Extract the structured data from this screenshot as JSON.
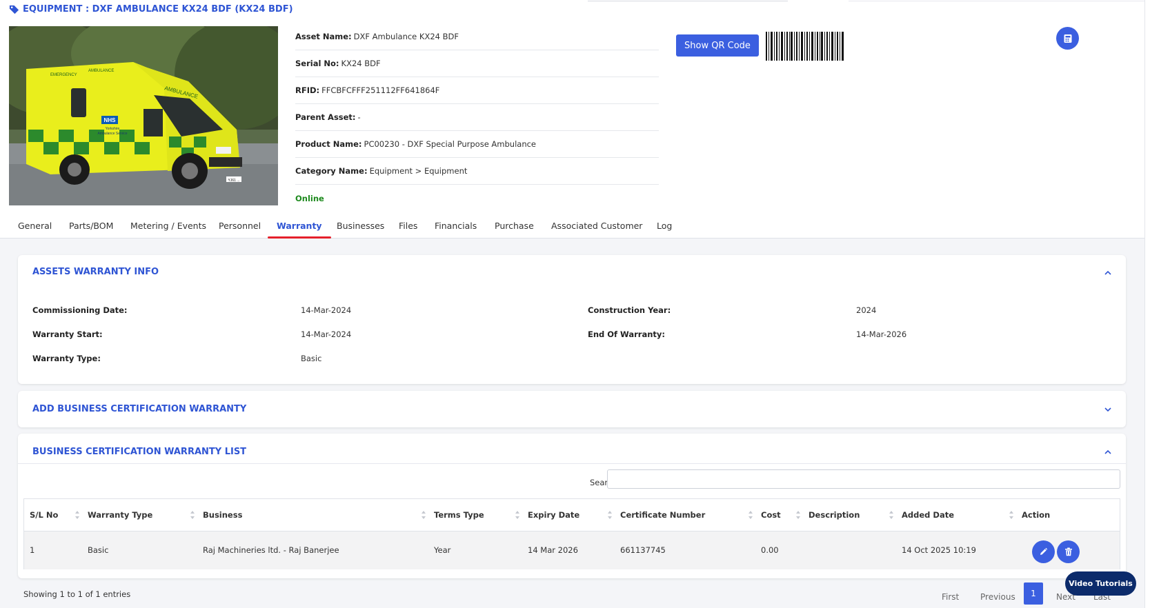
{
  "page": {
    "title": "EQUIPMENT : DXF AMBULANCE KX24 BDF (KX24 BDF)"
  },
  "asset": {
    "fields": [
      {
        "key": "Asset Name:",
        "value": "DXF Ambulance KX24 BDF"
      },
      {
        "key": "Serial No:",
        "value": "KX24 BDF"
      },
      {
        "key": "RFID:",
        "value": "FFCBFCFFF251112FF641864F"
      },
      {
        "key": "Parent Asset:",
        "value": "-"
      },
      {
        "key": "Product Name:",
        "value": "PC00230 - DXF Special Purpose Ambulance"
      },
      {
        "key": "Category Name:",
        "value": "Equipment > Equipment"
      }
    ],
    "status": "Online",
    "photo_text": {
      "emergency": "EMERGENCY",
      "ambulance": "AMBULANCE",
      "nhs": "NHS",
      "service_line1": "Yorkshire",
      "service_line2": "Ambulance Service",
      "front": "AMBULANCE",
      "plate": "YJ61 ..."
    }
  },
  "actions": {
    "qr_button": "Show QR Code"
  },
  "tabs": [
    "General",
    "Parts/BOM",
    "Metering / Events",
    "Personnel",
    "Warranty",
    "Businesses",
    "Files",
    "Financials",
    "Purchase",
    "Associated Customer",
    "Log"
  ],
  "active_tab": "Warranty",
  "warranty_info": {
    "title": "ASSETS WARRANTY INFO",
    "commissioning_date_label": "Commissioning Date:",
    "commissioning_date": "14-Mar-2024",
    "construction_year_label": "Construction Year:",
    "construction_year": "2024",
    "warranty_start_label": "Warranty Start:",
    "warranty_start": "14-Mar-2024",
    "end_of_warranty_label": "End Of Warranty:",
    "end_of_warranty": "14-Mar-2026",
    "warranty_type_label": "Warranty Type:",
    "warranty_type": "Basic"
  },
  "add_cert": {
    "title": "ADD BUSINESS CERTIFICATION WARRANTY"
  },
  "cert_list": {
    "title": "BUSINESS CERTIFICATION WARRANTY LIST",
    "search_label": "Search:",
    "search_value": "",
    "columns": [
      "S/L No",
      "Warranty Type",
      "Business",
      "Terms Type",
      "Expiry Date",
      "Certificate Number",
      "Cost",
      "Description",
      "Added Date",
      "Action"
    ],
    "rows": [
      {
        "sl": "1",
        "warranty_type": "Basic",
        "business": "Raj Machineries ltd. - Raj Banerjee",
        "terms_type": "Year",
        "expiry_date": "14 Mar 2026",
        "certificate_number": "661137745",
        "cost": "0.00",
        "description": "",
        "added_date": "14 Oct 2025 10:19"
      }
    ],
    "showing": "Showing 1 to 1 of 1 entries",
    "pagination": {
      "first": "First",
      "previous": "Previous",
      "current": "1",
      "next": "Next",
      "last": "Last"
    }
  },
  "video_tutorials": "Video Tutorials",
  "colors": {
    "accent": "#3b5fe0",
    "title_blue": "#2f55d4",
    "tab_underline": "#e5202b",
    "online_green": "#1e8a1e",
    "video_button": "#0c2b6b"
  }
}
